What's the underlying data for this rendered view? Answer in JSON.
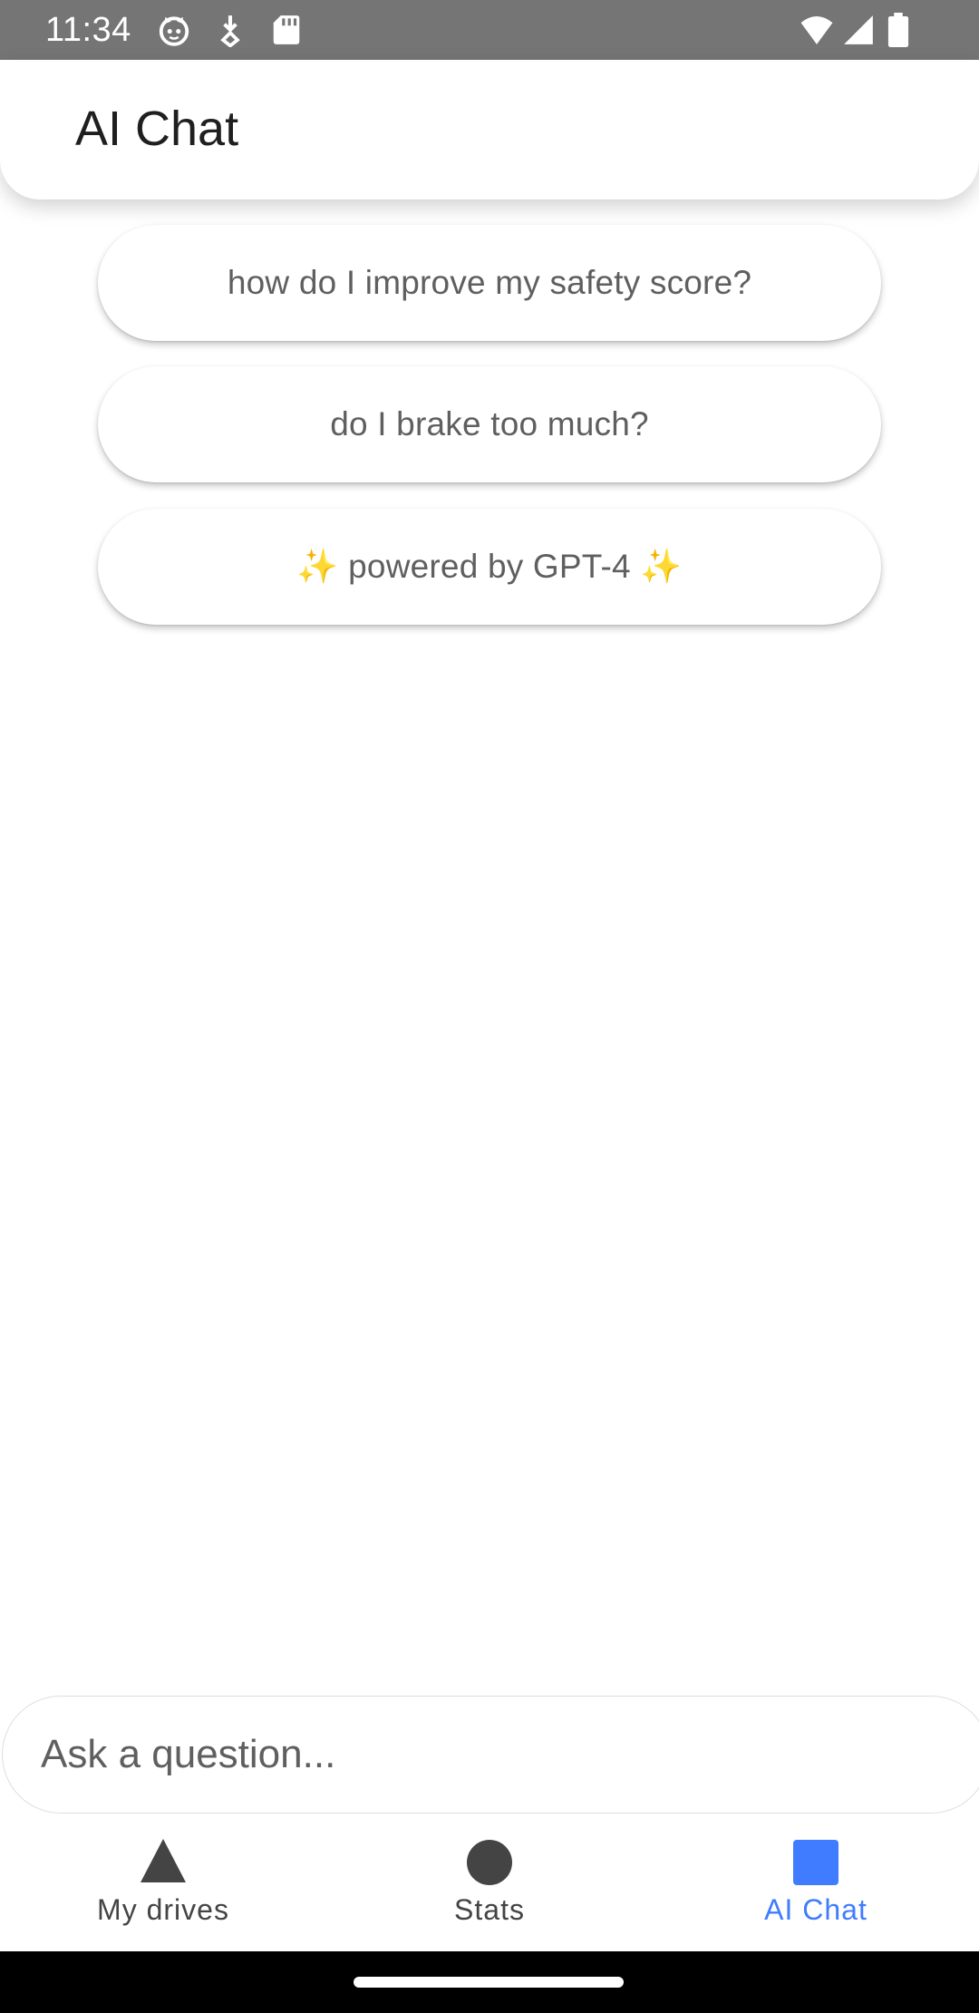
{
  "status_bar": {
    "time": "11:34",
    "background": "#757575",
    "left_icons": [
      "cat-face-icon",
      "download-arrow-icon",
      "sd-card-icon"
    ],
    "right_icons": [
      "wifi-icon",
      "cellular-signal-icon",
      "battery-icon"
    ]
  },
  "app_bar": {
    "title": "AI Chat"
  },
  "suggestions": [
    {
      "label": "how do I improve my safety score?"
    },
    {
      "label": "do I brake too much?"
    },
    {
      "label": "✨ powered by GPT-4 ✨"
    }
  ],
  "input": {
    "placeholder": "Ask a question...",
    "value": ""
  },
  "bottom_nav": {
    "active_color": "#3f7cff",
    "items": [
      {
        "label": "My drives",
        "icon": "triangle-icon",
        "active": false
      },
      {
        "label": "Stats",
        "icon": "circle-icon",
        "active": false
      },
      {
        "label": "AI Chat",
        "icon": "square-icon",
        "active": true
      }
    ]
  }
}
